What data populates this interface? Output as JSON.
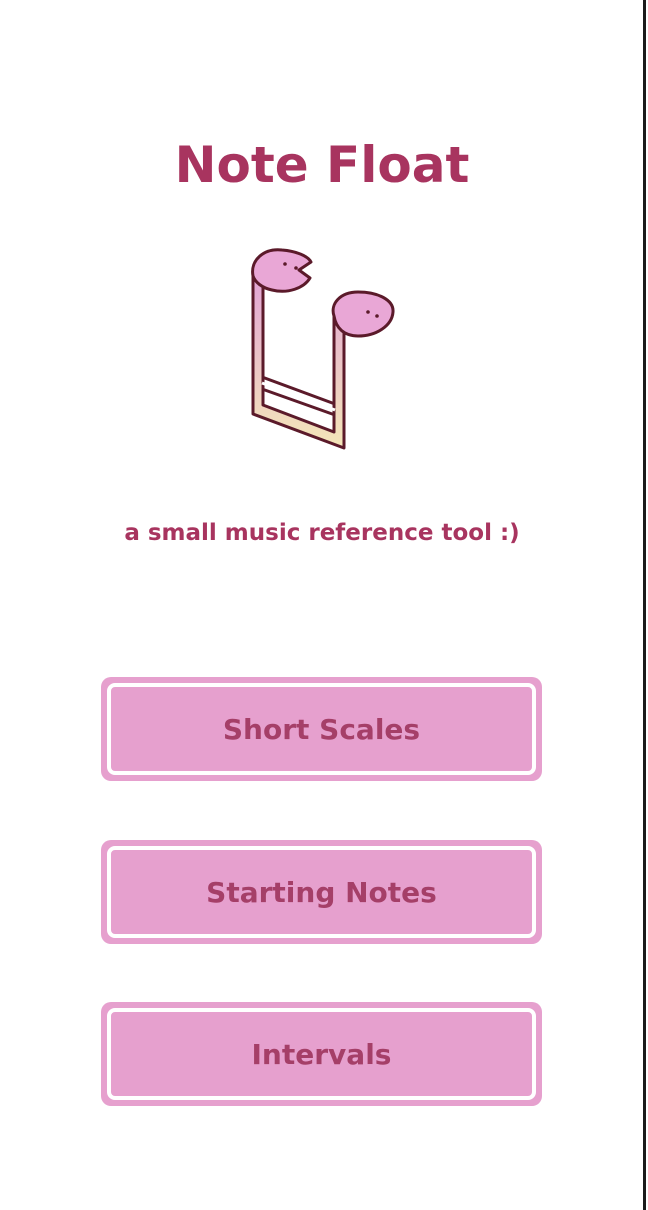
{
  "app": {
    "title": "Note Float",
    "subtitle": "a small music reference tool :)"
  },
  "logo": {
    "icon": "beamed-eighth-notes-with-faces-icon",
    "colors": {
      "head": "#e9a7d6",
      "gradient_top": "#e2a3d6",
      "gradient_bottom": "#f4e6b8",
      "outline": "#5b1a2a"
    }
  },
  "menu": {
    "buttons": [
      {
        "label": "Short Scales"
      },
      {
        "label": "Starting Notes"
      },
      {
        "label": "Intervals"
      }
    ]
  },
  "colors": {
    "accent_text": "#a8345f",
    "button_fill": "#e6a0ce",
    "button_border": "#ffffff",
    "background": "#ffffff"
  }
}
